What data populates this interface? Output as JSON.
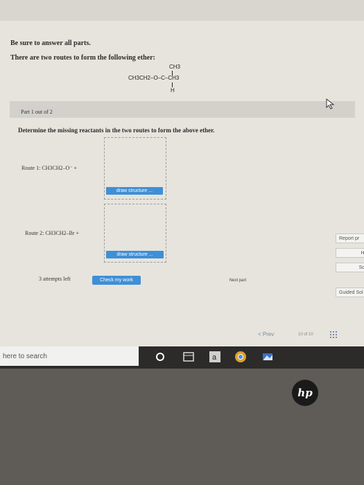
{
  "instructions": {
    "line1": "Be sure to answer all parts.",
    "line2": "There are two routes to form the following ether:"
  },
  "structure": {
    "top": "CH3",
    "main": "CH3CH2–O–C–CH3",
    "bottom": "H"
  },
  "part": {
    "label": "Part 1 out of 2"
  },
  "question": "Determine the missing reactants in the two routes to form the above ether.",
  "routes": [
    {
      "label": "Route 1: CH3CH2–O⁻  +"
    },
    {
      "label": "Route 2: CH3CH2–Br  +"
    }
  ],
  "draw_structure_label": "draw structure ...",
  "attempts": "3 attempts left",
  "check_label": "Check my work",
  "next_label": "Next part",
  "side_buttons": {
    "report": "Report pr",
    "hint": "Hint",
    "solution": "Solutio",
    "guided": "Guided Sol"
  },
  "navigation": {
    "prev": "< Prev",
    "page": "10 of 10"
  },
  "taskbar": {
    "search_placeholder": "here to search",
    "icons": [
      "cortana-icon",
      "task-view-icon",
      "amazon-icon",
      "chrome-icon",
      "photos-icon"
    ]
  },
  "brand": {
    "logo": "hp"
  },
  "colors": {
    "accent": "#3f8fd6"
  }
}
